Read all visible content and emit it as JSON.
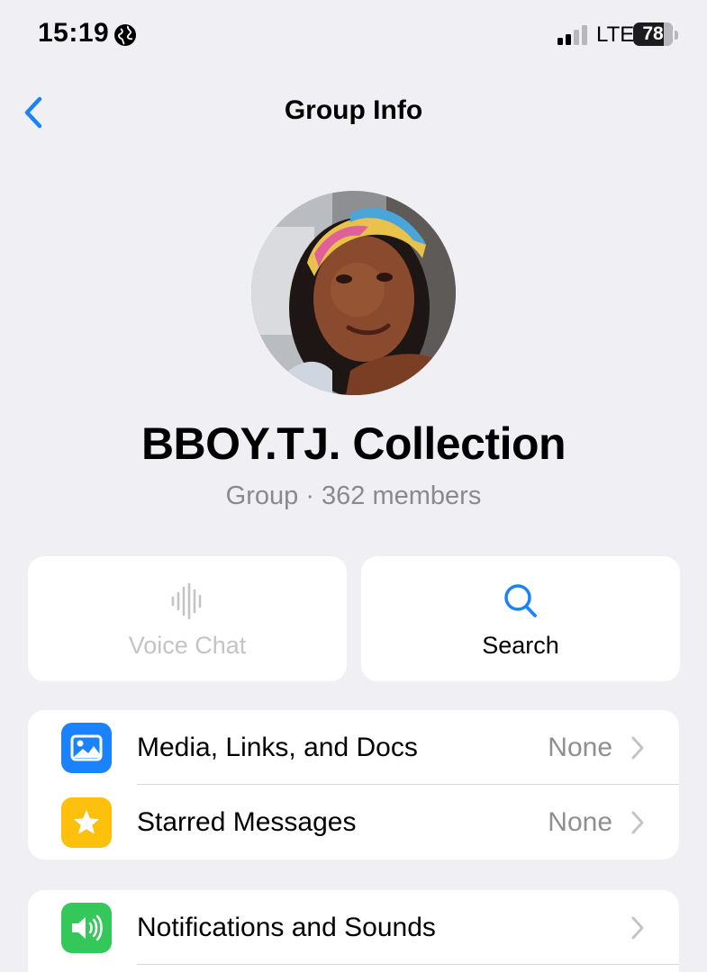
{
  "status_bar": {
    "time": "15:19",
    "network": "LTE",
    "battery": "78",
    "battery_level": 0.78
  },
  "nav": {
    "title": "Group Info",
    "back_icon": "chevron-left-icon"
  },
  "group": {
    "name": "BBOY.TJ. Collection",
    "subtitle": "Group · 362 members"
  },
  "actions": [
    {
      "label": "Voice Chat",
      "icon": "waveform-icon",
      "enabled": false
    },
    {
      "label": "Search",
      "icon": "search-icon",
      "enabled": true
    }
  ],
  "list_sections": [
    [
      {
        "label": "Media, Links, and Docs",
        "value": "None",
        "icon": "photo-icon",
        "color": "#1a82fb"
      },
      {
        "label": "Starred Messages",
        "value": "None",
        "icon": "star-icon",
        "color": "#fdc00c"
      }
    ],
    [
      {
        "label": "Notifications and Sounds",
        "value": "",
        "icon": "speaker-icon",
        "color": "#34c759"
      }
    ]
  ],
  "colors": {
    "accent": "#1a82fb",
    "background": "#efeff4",
    "disabled_text": "#c4c4c7"
  }
}
